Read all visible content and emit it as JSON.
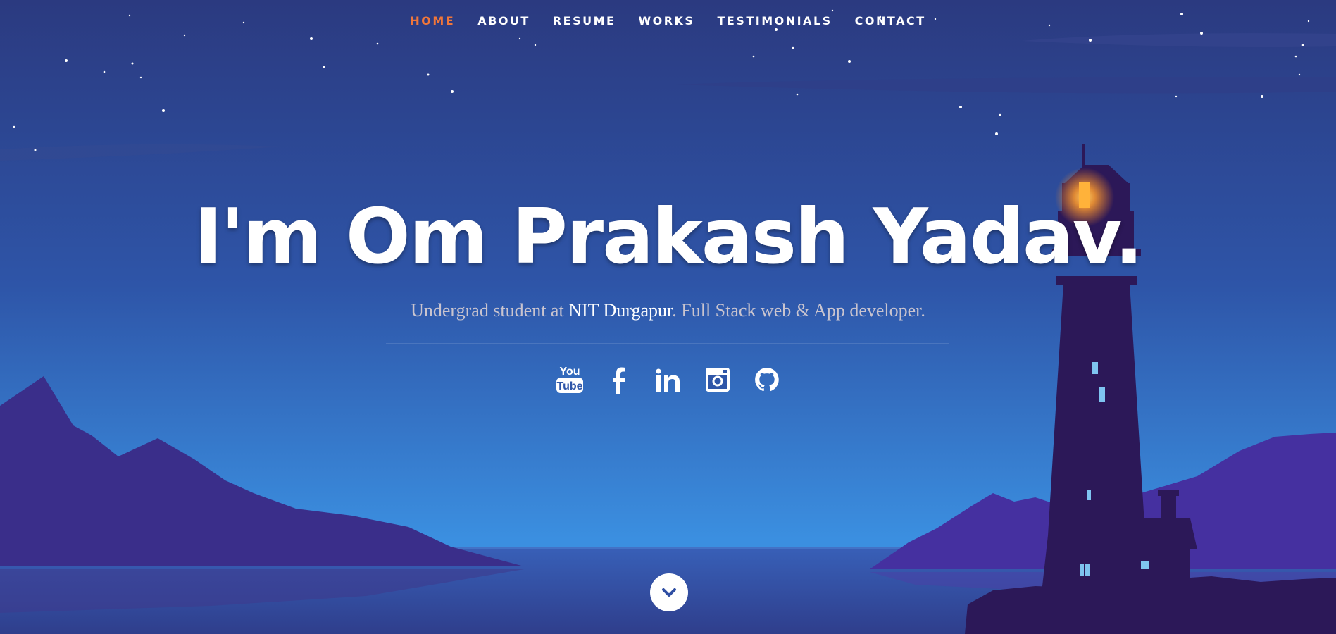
{
  "nav": {
    "items": [
      {
        "label": "HOME",
        "active": true
      },
      {
        "label": "ABOUT",
        "active": false
      },
      {
        "label": "RESUME",
        "active": false
      },
      {
        "label": "WORKS",
        "active": false
      },
      {
        "label": "TESTIMONIALS",
        "active": false
      },
      {
        "label": "CONTACT",
        "active": false
      }
    ]
  },
  "hero": {
    "headline": "I'm Om Prakash Yadav.",
    "tagline_prefix": "Undergrad student at ",
    "tagline_school": "NIT Durgapur",
    "tagline_suffix": ". Full Stack web & App developer."
  },
  "social": {
    "icons": [
      "youtube-icon",
      "facebook-icon",
      "linkedin-icon",
      "instagram-icon",
      "github-icon"
    ]
  },
  "scroll_down": {
    "icon": "chevron-down-icon"
  },
  "colors": {
    "accent": "#f0763a",
    "sky_top": "#2b3a80",
    "sky_bottom": "#3b8fe0",
    "water": "#3353a6",
    "mountains": "#3a2e8a",
    "lighthouse": "#2c1858",
    "light": "#ffb23a",
    "window": "#7fc4f0"
  }
}
